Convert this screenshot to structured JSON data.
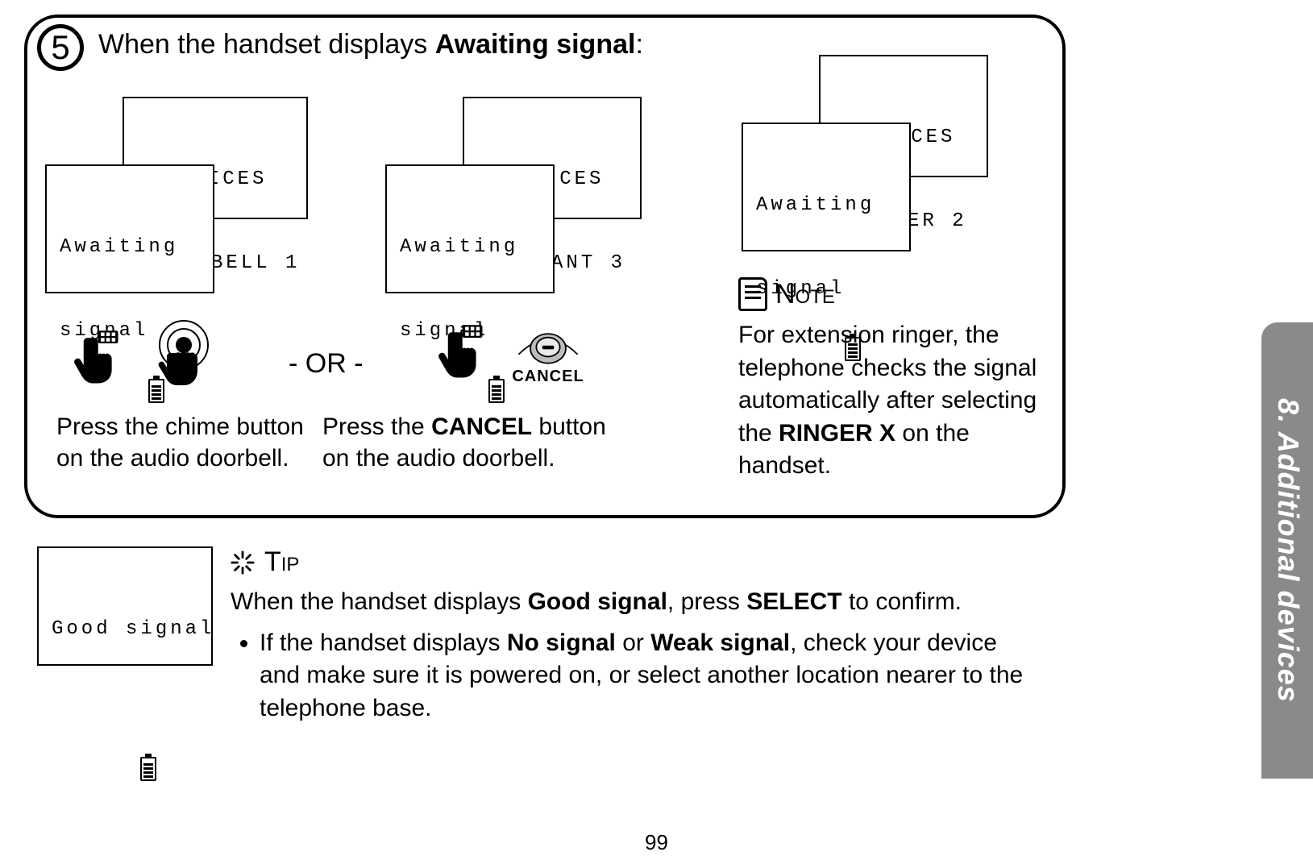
{
  "step": {
    "number": "5",
    "heading_pre": "When the handset displays ",
    "heading_bold": "Awaiting signal",
    "heading_post": ":"
  },
  "lcd1": {
    "title": "DEVICES",
    "sel": ">DOORBELL 1",
    "await1": "Awaiting",
    "await2": "signal"
  },
  "lcd2": {
    "title": "DEVICES",
    "sel": ">PENDANT 3",
    "await1": "Awaiting",
    "await2": "signal"
  },
  "lcd3": {
    "title": "DEVICES",
    "sel": ">RINGER 2",
    "await1": "Awaiting",
    "await2": "signal"
  },
  "or_label": "- OR -",
  "action1": "Press the chime button on the audio doorbell.",
  "action2_pre": "Press the ",
  "action2_bold": "CANCEL",
  "action2_post": " button on the audio doorbell.",
  "cancel_btn_label": "CANCEL",
  "note": {
    "title": "Note",
    "body_pre": "For extension ringer, the telephone checks the signal automatically after selecting the ",
    "body_bold": "RINGER X",
    "body_post": " on the handset."
  },
  "tip": {
    "title": "Tip",
    "line1_pre": "When the handset displays ",
    "line1_b1": "Good signal",
    "line1_mid": ", press ",
    "line1_b2": "SELECT",
    "line1_post": " to confirm.",
    "bullet_pre": "If the handset displays ",
    "bullet_b1": "No signal",
    "bullet_mid": " or ",
    "bullet_b2": "Weak signal",
    "bullet_post": ", check your device and make sure it is powered on, or select another location nearer to the telephone base."
  },
  "good_lcd": "Good signal",
  "side_tab": "8. Additional devices",
  "page_number": "99"
}
